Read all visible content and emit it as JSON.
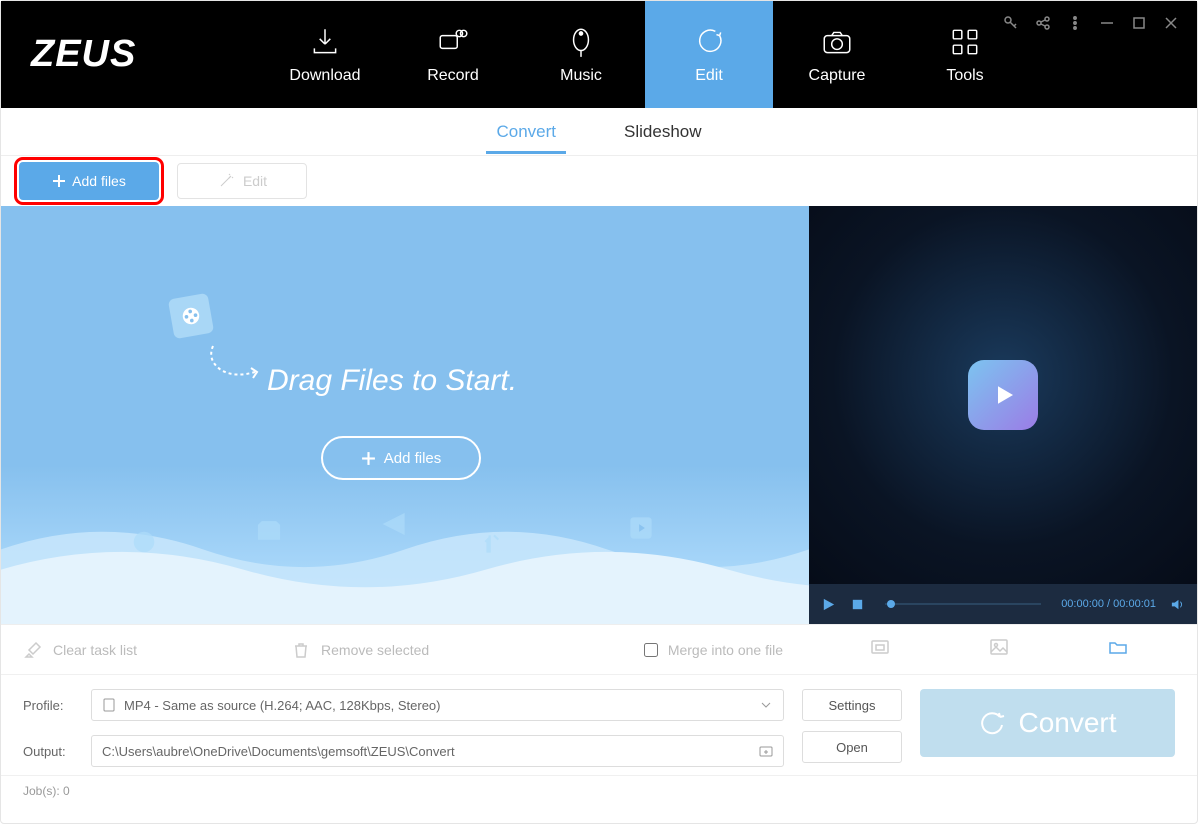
{
  "app": {
    "logo": "ZEUS"
  },
  "nav": [
    {
      "label": "Download",
      "name": "download"
    },
    {
      "label": "Record",
      "name": "record"
    },
    {
      "label": "Music",
      "name": "music"
    },
    {
      "label": "Edit",
      "name": "edit"
    },
    {
      "label": "Capture",
      "name": "capture"
    },
    {
      "label": "Tools",
      "name": "tools"
    }
  ],
  "tabs": {
    "convert": "Convert",
    "slideshow": "Slideshow"
  },
  "toolbar": {
    "add_files": "Add files",
    "edit": "Edit"
  },
  "drop": {
    "hero": "Drag Files to Start.",
    "add_files": "Add files"
  },
  "player": {
    "time": "00:00:00 / 00:00:01"
  },
  "options": {
    "clear": "Clear task list",
    "remove": "Remove selected",
    "merge": "Merge into one file"
  },
  "profile": {
    "label": "Profile:",
    "value": "MP4 - Same as source (H.264; AAC, 128Kbps, Stereo)",
    "settings": "Settings"
  },
  "output": {
    "label": "Output:",
    "value": "C:\\Users\\aubre\\OneDrive\\Documents\\gemsoft\\ZEUS\\Convert",
    "open": "Open"
  },
  "convert": {
    "label": "Convert"
  },
  "footer": {
    "jobs": "Job(s): 0"
  }
}
